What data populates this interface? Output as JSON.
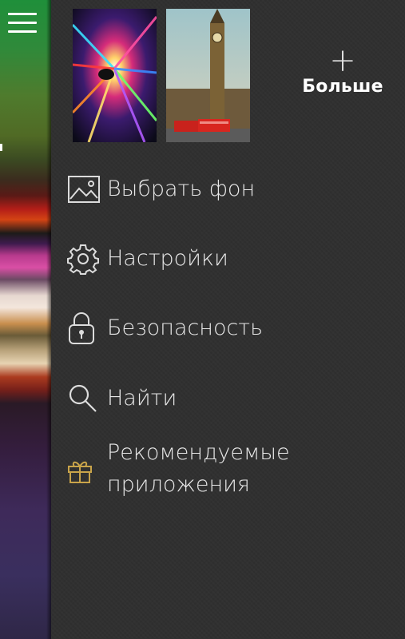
{
  "wallpaper_strip": {
    "menu_icon": "hamburger-menu-icon"
  },
  "thumbnails": [
    {
      "name": "light-tunnel-wallpaper"
    },
    {
      "name": "big-ben-london-wallpaper"
    }
  ],
  "more": {
    "icon": "plus-icon",
    "label": "Больше"
  },
  "menu": {
    "choose_background": {
      "icon": "image-icon",
      "label": "Выбрать фон"
    },
    "settings": {
      "icon": "gear-icon",
      "label": "Настройки"
    },
    "security": {
      "icon": "lock-icon",
      "label": "Безопасность"
    },
    "search": {
      "icon": "search-icon",
      "label": "Найти"
    },
    "recommended_apps": {
      "icon": "gift-icon",
      "label_line1": "Рекомендуемые",
      "label_line2": "приложения"
    }
  },
  "colors": {
    "panel_bg": "#303030",
    "text": "#e8e8e8",
    "gift_accent": "#c9a44a"
  }
}
